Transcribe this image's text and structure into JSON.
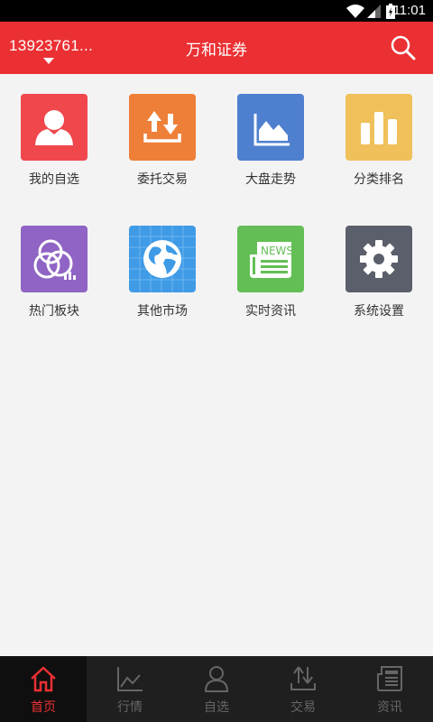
{
  "status_bar": {
    "time": "11:01"
  },
  "header": {
    "account": "13923761...",
    "title": "万和证券"
  },
  "menu": [
    {
      "label": "我的自选",
      "icon": "person-icon",
      "color": "#f0474d"
    },
    {
      "label": "委托交易",
      "icon": "transfer-icon",
      "color": "#ee7f38"
    },
    {
      "label": "大盘走势",
      "icon": "area-chart-icon",
      "color": "#4f7fcf"
    },
    {
      "label": "分类排名",
      "icon": "bar-chart-icon",
      "color": "#f0c05a"
    },
    {
      "label": "热门板块",
      "icon": "circles-icon",
      "color": "#8f64c4"
    },
    {
      "label": "其他市场",
      "icon": "globe-icon",
      "color": "#3f9be6"
    },
    {
      "label": "实时资讯",
      "icon": "news-icon",
      "color": "#63bf55"
    },
    {
      "label": "系统设置",
      "icon": "gear-icon",
      "color": "#5b5f6b"
    }
  ],
  "tabs": [
    {
      "label": "首页",
      "icon": "home-icon",
      "active": true
    },
    {
      "label": "行情",
      "icon": "line-chart-icon",
      "active": false
    },
    {
      "label": "自选",
      "icon": "person-outline-icon",
      "active": false
    },
    {
      "label": "交易",
      "icon": "transfer-icon",
      "active": false
    },
    {
      "label": "资讯",
      "icon": "newspaper-icon",
      "active": false
    }
  ]
}
